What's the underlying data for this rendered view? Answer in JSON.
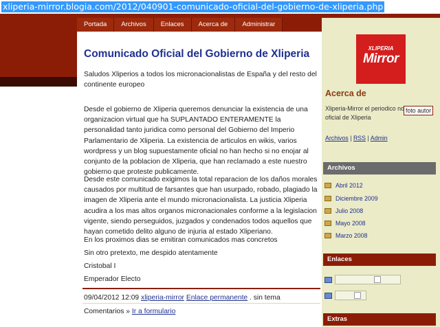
{
  "browser": {
    "url": "xliperia-mirror.blogia.com/2012/040901-comunicado-oficial-del-gobierno-de-xliperia.php"
  },
  "nav": [
    "Portada",
    "Archivos",
    "Enlaces",
    "Acerca de",
    "Administrar"
  ],
  "post": {
    "title": "Comunicado Oficial del Gobierno de Xliperia",
    "paragraphs": [
      "Saludos Xliperios a todos los micronacionalistas de España y del resto del continente europeo",
      "Desde el gobierno de Xliperia queremos denunciar la existencia de una organizacion virtual que ha SUPLANTADO ENTERAMENTE la personalidad tanto juridica como personal del Gobierno del Imperio Parlamentario de Xliperia. La existencia de articulos en wikis, varios wordpress y un blog supuestamente oficial no han hecho si no enojar al conjunto de la poblacion de Xliperia, que han reclamado a este nuestro gobierno que proteste publicamente.",
      "Desde este comunicado exigimos la total reparacion de los daños morales causados por multitud de farsantes que han usurpado, robado, plagiado la imagen de Xliperia ante el mundo micronacionalista. La justicia Xliperia acudira a los mas altos organos micronacionales conforme a la legislacion vigente, siendo perseguidos, juzgados y condenados todos aquellos que hayan cometido delito alguno de injuria al estado Xliperiano.",
      "En los proximos dias se emitiran comunicados mas concretos",
      "Sin otro pretexto, me despido atentamente",
      "Cristobal I",
      "Emperador Electo"
    ],
    "meta": {
      "date": "09/04/2012 12:09",
      "author": "xliperia-mirror",
      "permalink": "Enlace permanente",
      "topic": ". sin tema"
    },
    "comments": {
      "label": "Comentarios »",
      "link": "Ir a formulario"
    }
  },
  "sidebar": {
    "logo": {
      "top": "XLIPERIA",
      "main": "Mirror"
    },
    "about": {
      "title": "Acerca de",
      "text": "Xliperia-Mirror el periodico no oficial de Xliperia",
      "photo": "foto autor",
      "links": [
        "Archivos",
        "RSS",
        "Admin"
      ],
      "sep": "|"
    },
    "archivos": {
      "title": "Archivos",
      "items": [
        "Abril 2012",
        "Diciembre 2009",
        "Julio 2008",
        "Mayo 2008",
        "Marzo 2008"
      ]
    },
    "enlaces": {
      "title": "Enlaces"
    },
    "extras": {
      "title": "Extras"
    }
  }
}
